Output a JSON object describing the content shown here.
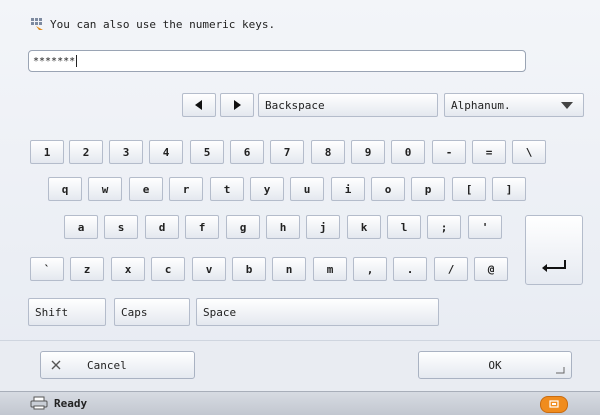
{
  "hint": {
    "text": "You can also use the numeric keys."
  },
  "input": {
    "value": "*******"
  },
  "nav": {
    "backspace": "Backspace",
    "mode": "Alphanum."
  },
  "rows": [
    [
      "1",
      "2",
      "3",
      "4",
      "5",
      "6",
      "7",
      "8",
      "9",
      "0",
      "-",
      "=",
      "\\"
    ],
    [
      "q",
      "w",
      "e",
      "r",
      "t",
      "y",
      "u",
      "i",
      "o",
      "p",
      "[",
      "]"
    ],
    [
      "a",
      "s",
      "d",
      "f",
      "g",
      "h",
      "j",
      "k",
      "l",
      ";",
      "'"
    ],
    [
      "`",
      "z",
      "x",
      "c",
      "v",
      "b",
      "n",
      "m",
      ",",
      ".",
      "/",
      "@"
    ]
  ],
  "bottom": {
    "shift": "Shift",
    "caps": "Caps",
    "space": "Space"
  },
  "actions": {
    "cancel": "Cancel",
    "ok": "OK"
  },
  "status": {
    "text": "Ready"
  },
  "colors": {
    "accent": "#f08c1e"
  }
}
